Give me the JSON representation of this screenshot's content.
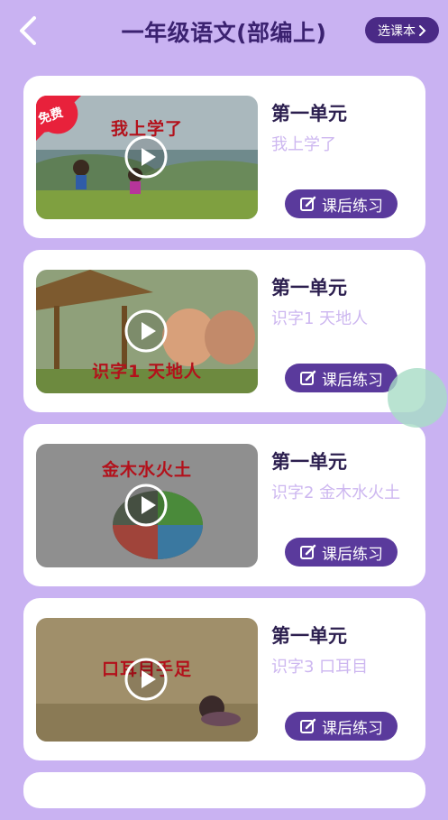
{
  "header": {
    "title": "一年级语文(部编上)",
    "pick_label": "选课本"
  },
  "badge_free": "免费",
  "action_label": "课后练习",
  "cards": [
    {
      "unit": "第一单元",
      "lesson": "我上学了",
      "thumb_text": "我上学了"
    },
    {
      "unit": "第一单元",
      "lesson": "识字1 天地人",
      "thumb_text": "识字1 天地人"
    },
    {
      "unit": "第一单元",
      "lesson": "识字2 金木水火土",
      "thumb_text": "金木水火土"
    },
    {
      "unit": "第一单元",
      "lesson": "识字3 口耳目",
      "thumb_text": "口耳目手足"
    }
  ],
  "colors": {
    "background": "#c9b2f2",
    "accent": "#5a3a9c",
    "title": "#3b2270",
    "free_badge": "#e8213b"
  }
}
